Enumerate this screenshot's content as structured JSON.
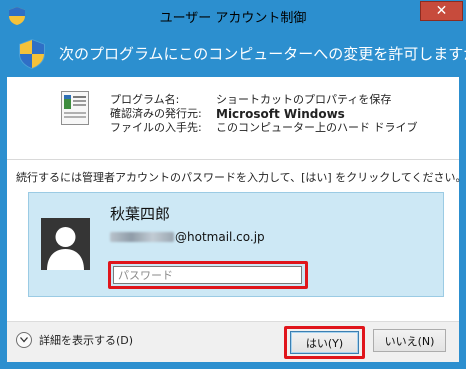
{
  "window": {
    "title": "ユーザー アカウント制御",
    "close_glyph": "✕"
  },
  "header": {
    "question": "次のプログラムにこのコンピューターへの変更を許可しますか?"
  },
  "program_info": {
    "rows": [
      {
        "label": "プログラム名:",
        "value": "ショートカットのプロパティを保存"
      },
      {
        "label": "確認済みの発行元:",
        "value": "Microsoft Windows"
      },
      {
        "label": "ファイルの入手先:",
        "value": "このコンピューター上のハード ドライブ"
      }
    ]
  },
  "instruction": "続行するには管理者アカウントのパスワードを入力して、[はい] をクリックしてください。",
  "credential": {
    "username": "秋葉四郎",
    "email_domain": "@hotmail.co.jp",
    "password_placeholder": "パスワード"
  },
  "footer": {
    "details_label": "詳細を表示する(D)",
    "yes_label": "はい(Y)",
    "no_label": "いいえ(N)"
  },
  "colors": {
    "accent": "#2c8fcf",
    "highlight": "#e0151b",
    "tile_bg": "#cde8f5"
  },
  "icons": [
    "uac-shield-icon",
    "close-icon",
    "program-icon",
    "user-avatar-icon",
    "chevron-down-icon"
  ]
}
